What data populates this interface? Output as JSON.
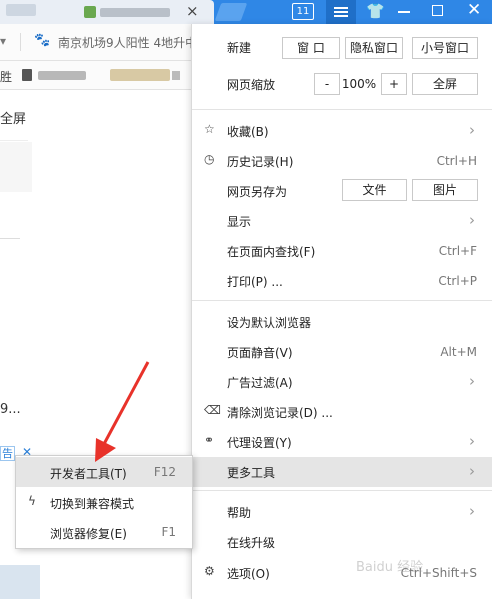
{
  "titlebar": {
    "tab_count": "11",
    "tab_close": "×",
    "menu_button": "menu",
    "close_button": "✕"
  },
  "address": {
    "text": "南京机场9人阳性 4地升中"
  },
  "bookmarks": {
    "first": "胜"
  },
  "page": {
    "title_fragment": "全屏",
    "number_fragment": "9...",
    "ad_tag": "告",
    "ad_close": "✕"
  },
  "menu": {
    "new_label": "新建",
    "new_buttons": [
      "窗 口",
      "隐私窗口",
      "小号窗口"
    ],
    "zoom_label": "网页缩放",
    "zoom_minus": "-",
    "zoom_value": "100%",
    "zoom_plus": "+",
    "zoom_full": "全屏",
    "favorites": "收藏(B)",
    "history": "历史记录(H)",
    "history_sc": "Ctrl+H",
    "save_as": "网页另存为",
    "save_file": "文件",
    "save_image": "图片",
    "display": "显示",
    "find": "在页面内查找(F)",
    "find_sc": "Ctrl+F",
    "print": "打印(P) ...",
    "print_sc": "Ctrl+P",
    "default_browser": "设为默认浏览器",
    "mute": "页面静音(V)",
    "mute_sc": "Alt+M",
    "ad_filter": "广告过滤(A)",
    "clear": "清除浏览记录(D) ...",
    "proxy": "代理设置(Y)",
    "more_tools": "更多工具",
    "help": "帮助",
    "upgrade": "在线升级",
    "options": "选项(O)",
    "options_sc": "Ctrl+Shift+S"
  },
  "submenu": {
    "devtools": "开发者工具(T)",
    "devtools_sc": "F12",
    "compat": "切换到兼容模式",
    "repair": "浏览器修复(E)",
    "repair_sc": "F1"
  },
  "colors": {
    "titlebar": "#2f87e6",
    "highlight": "#e5e5e5",
    "arrow": "#e8322a"
  }
}
